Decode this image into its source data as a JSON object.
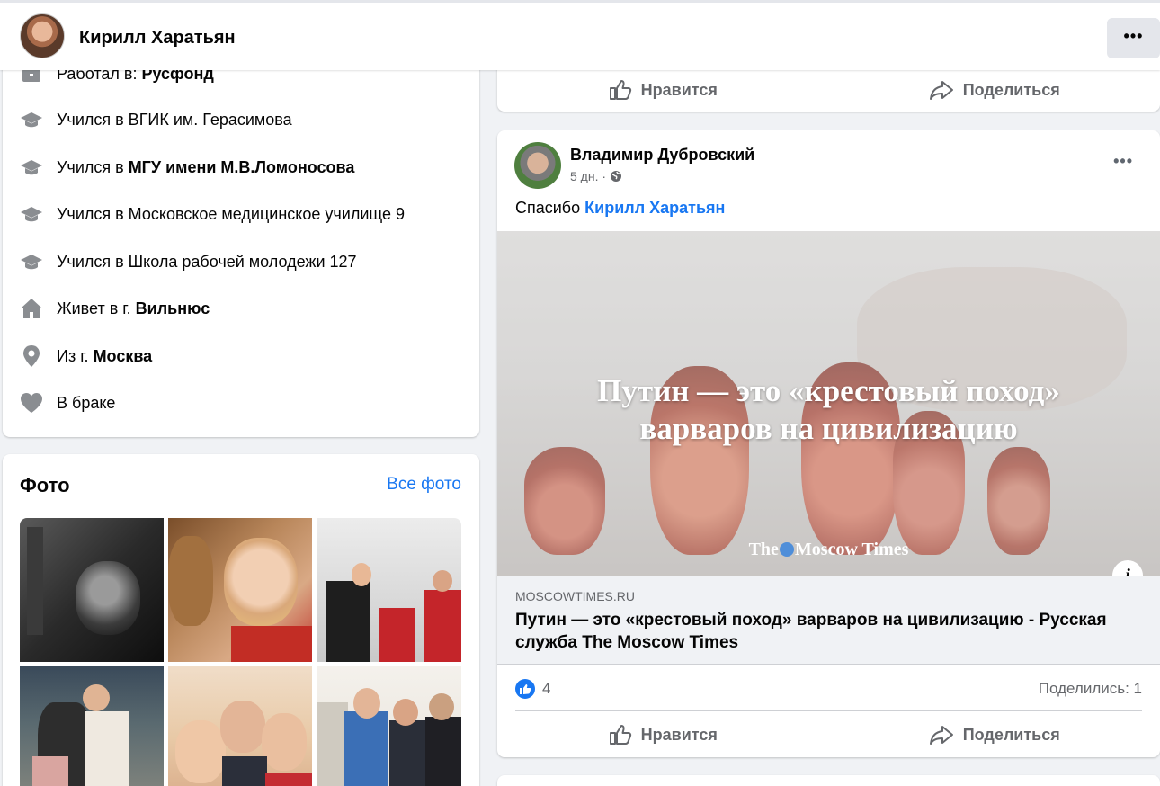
{
  "header": {
    "name": "Кирилл Харатьян",
    "more": "•••"
  },
  "intro": {
    "items": [
      {
        "icon": "briefcase-icon",
        "prefix": "Работал в: ",
        "bold": "Русфонд"
      },
      {
        "icon": "graduation-cap-icon",
        "prefix": "Учился в ВГИК им. Герасимова",
        "bold": ""
      },
      {
        "icon": "graduation-cap-icon",
        "prefix": "Учился в ",
        "bold": "МГУ имени М.В.Ломоносова"
      },
      {
        "icon": "graduation-cap-icon",
        "prefix": "Учился в Московское медицинское училище 9",
        "bold": ""
      },
      {
        "icon": "graduation-cap-icon",
        "prefix": "Учился в Школа рабочей молодежи 127",
        "bold": ""
      },
      {
        "icon": "home-icon",
        "prefix": "Живет в г. ",
        "bold": "Вильнюс"
      },
      {
        "icon": "location-pin-icon",
        "prefix": "Из г. ",
        "bold": "Москва"
      },
      {
        "icon": "heart-icon",
        "prefix": "В браке",
        "bold": ""
      }
    ]
  },
  "photos": {
    "title": "Фото",
    "all_label": "Все фото"
  },
  "prev_post": {
    "like_label": "Нравится",
    "share_label": "Поделиться"
  },
  "post": {
    "author": "Владимир Дубровский",
    "time": "5 дн. ·",
    "more": "•••",
    "text_prefix": "Спасибо ",
    "mention": "Кирилл Харатьян",
    "image": {
      "headline_line1": "Путин — это «крестовый поход»",
      "headline_line2": "варваров на цивилизацию",
      "brand_left": "The",
      "brand_right": "Moscow Times",
      "info": "i"
    },
    "link": {
      "domain": "MOSCOWTIMES.RU",
      "title": "Путин — это «крестовый поход» варваров на цивилизацию - Русская служба The Moscow Times"
    },
    "likes": "4",
    "shares": "Поделились: 1",
    "like_label": "Нравится",
    "share_label": "Поделиться"
  },
  "colors": {
    "accent": "#1877f2",
    "muted": "#65676b",
    "bg": "#f0f2f5"
  }
}
